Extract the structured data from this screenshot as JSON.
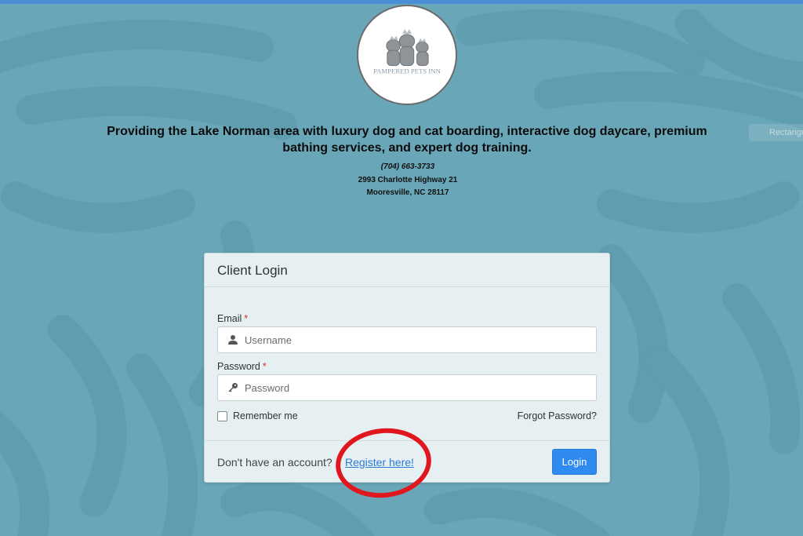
{
  "colors": {
    "background": "#69a6b7",
    "accent_bar": "#4a8fd6",
    "login_button": "#2f8bf0",
    "link": "#2a7bd6",
    "required_star": "#d0312d",
    "annotation_circle": "#e0171e"
  },
  "logo": {
    "text": "PAMPERED PETS INN",
    "icon": "dog-and-cat-illustration"
  },
  "tagline": "Providing the Lake Norman area with luxury dog and cat boarding, interactive dog daycare, premium bathing services, and expert dog training.",
  "contact": {
    "phone": "(704) 663-3733",
    "street": "2993 Charlotte Highway 21",
    "city": "Mooresville, NC 28117"
  },
  "ghost_tab": "Rectangular",
  "login": {
    "title": "Client Login",
    "email_label": "Email",
    "password_label": "Password",
    "required_mark": "*",
    "email_placeholder": "Username",
    "password_placeholder": "Password",
    "email_icon": "user-icon",
    "password_icon": "key-icon",
    "remember_label": "Remember me",
    "forgot_label": "Forgot Password?",
    "no_account_text": "Don't have an account?",
    "register_label": "Register here!",
    "login_button": "Login"
  }
}
